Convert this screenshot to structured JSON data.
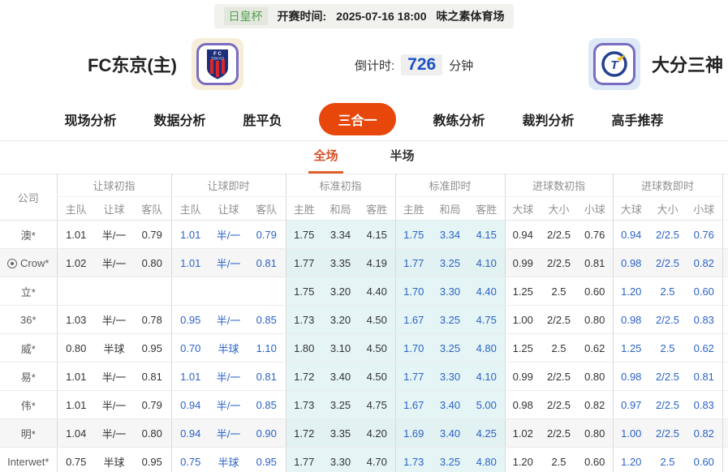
{
  "header": {
    "league": "日皇杯",
    "kickoff_label": "开赛时间:",
    "kickoff_time": "2025-07-16 18:00",
    "venue": "味之素体育场",
    "home_team": "FC东京(主)",
    "away_team": "大分三神",
    "countdown_label": "倒计时:",
    "countdown_value": "726",
    "countdown_unit": "分钟"
  },
  "nav": {
    "tabs": [
      {
        "label": "现场分析",
        "active": false
      },
      {
        "label": "数据分析",
        "active": false
      },
      {
        "label": "胜平负",
        "active": false
      },
      {
        "label": "三合一",
        "active": true
      },
      {
        "label": "教练分析",
        "active": false
      },
      {
        "label": "裁判分析",
        "active": false
      },
      {
        "label": "高手推荐",
        "active": false
      }
    ]
  },
  "subtabs": [
    {
      "label": "全场",
      "active": true
    },
    {
      "label": "半场",
      "active": false
    }
  ],
  "colors": {
    "accent_orange": "#e8470b",
    "subtab_orange": "#d4532a",
    "live_blue": "#2c63c8",
    "countdown_blue": "#1b50c4",
    "league_green": "#4fa44f",
    "standard_cyan_bg": "#e5f5f5"
  },
  "table": {
    "company_header": "公司",
    "groups": [
      {
        "label": "让球初指",
        "cols": [
          "主队",
          "让球",
          "客队"
        ],
        "live": false,
        "cyan": false
      },
      {
        "label": "让球即时",
        "cols": [
          "主队",
          "让球",
          "客队"
        ],
        "live": true,
        "cyan": false
      },
      {
        "label": "标准初指",
        "cols": [
          "主胜",
          "和局",
          "客胜"
        ],
        "live": false,
        "cyan": true
      },
      {
        "label": "标准即时",
        "cols": [
          "主胜",
          "和局",
          "客胜"
        ],
        "live": true,
        "cyan": true
      },
      {
        "label": "进球数初指",
        "cols": [
          "大球",
          "大小",
          "小球"
        ],
        "live": false,
        "cyan": false
      },
      {
        "label": "进球数即时",
        "cols": [
          "大球",
          "大小",
          "小球"
        ],
        "live": true,
        "cyan": false
      }
    ],
    "rows": [
      {
        "company": "澳*",
        "icon": false,
        "highlight": false,
        "handicap_initial": [
          "1.01",
          "半/一",
          "0.79"
        ],
        "handicap_live": [
          "1.01",
          "半/一",
          "0.79"
        ],
        "standard_initial": [
          "1.75",
          "3.34",
          "4.15"
        ],
        "standard_live": [
          "1.75",
          "3.34",
          "4.15"
        ],
        "goals_initial": [
          "0.94",
          "2/2.5",
          "0.76"
        ],
        "goals_live": [
          "0.94",
          "2/2.5",
          "0.76"
        ]
      },
      {
        "company": "Crow*",
        "icon": true,
        "highlight": true,
        "handicap_initial": [
          "1.02",
          "半/一",
          "0.80"
        ],
        "handicap_live": [
          "1.01",
          "半/一",
          "0.81"
        ],
        "standard_initial": [
          "1.77",
          "3.35",
          "4.19"
        ],
        "standard_live": [
          "1.77",
          "3.25",
          "4.10"
        ],
        "goals_initial": [
          "0.99",
          "2/2.5",
          "0.81"
        ],
        "goals_live": [
          "0.98",
          "2/2.5",
          "0.82"
        ]
      },
      {
        "company": "立*",
        "icon": false,
        "highlight": false,
        "handicap_initial": [
          "",
          "",
          ""
        ],
        "handicap_live": [
          "",
          "",
          ""
        ],
        "standard_initial": [
          "1.75",
          "3.20",
          "4.40"
        ],
        "standard_live": [
          "1.70",
          "3.30",
          "4.40"
        ],
        "goals_initial": [
          "1.25",
          "2.5",
          "0.60"
        ],
        "goals_live": [
          "1.20",
          "2.5",
          "0.60"
        ]
      },
      {
        "company": "36*",
        "icon": false,
        "highlight": false,
        "handicap_initial": [
          "1.03",
          "半/一",
          "0.78"
        ],
        "handicap_live": [
          "0.95",
          "半/一",
          "0.85"
        ],
        "standard_initial": [
          "1.73",
          "3.20",
          "4.50"
        ],
        "standard_live": [
          "1.67",
          "3.25",
          "4.75"
        ],
        "goals_initial": [
          "1.00",
          "2/2.5",
          "0.80"
        ],
        "goals_live": [
          "0.98",
          "2/2.5",
          "0.83"
        ]
      },
      {
        "company": "威*",
        "icon": false,
        "highlight": false,
        "handicap_initial": [
          "0.80",
          "半球",
          "0.95"
        ],
        "handicap_live": [
          "0.70",
          "半球",
          "1.10"
        ],
        "standard_initial": [
          "1.80",
          "3.10",
          "4.50"
        ],
        "standard_live": [
          "1.70",
          "3.25",
          "4.80"
        ],
        "goals_initial": [
          "1.25",
          "2.5",
          "0.62"
        ],
        "goals_live": [
          "1.25",
          "2.5",
          "0.62"
        ]
      },
      {
        "company": "易*",
        "icon": false,
        "highlight": false,
        "handicap_initial": [
          "1.01",
          "半/一",
          "0.81"
        ],
        "handicap_live": [
          "1.01",
          "半/一",
          "0.81"
        ],
        "standard_initial": [
          "1.72",
          "3.40",
          "4.50"
        ],
        "standard_live": [
          "1.77",
          "3.30",
          "4.10"
        ],
        "goals_initial": [
          "0.99",
          "2/2.5",
          "0.80"
        ],
        "goals_live": [
          "0.98",
          "2/2.5",
          "0.81"
        ]
      },
      {
        "company": "伟*",
        "icon": false,
        "highlight": false,
        "handicap_initial": [
          "1.01",
          "半/一",
          "0.79"
        ],
        "handicap_live": [
          "0.94",
          "半/一",
          "0.85"
        ],
        "standard_initial": [
          "1.73",
          "3.25",
          "4.75"
        ],
        "standard_live": [
          "1.67",
          "3.40",
          "5.00"
        ],
        "goals_initial": [
          "0.98",
          "2/2.5",
          "0.82"
        ],
        "goals_live": [
          "0.97",
          "2/2.5",
          "0.83"
        ]
      },
      {
        "company": "明*",
        "icon": false,
        "highlight": true,
        "handicap_initial": [
          "1.04",
          "半/一",
          "0.80"
        ],
        "handicap_live": [
          "0.94",
          "半/一",
          "0.90"
        ],
        "standard_initial": [
          "1.72",
          "3.35",
          "4.20"
        ],
        "standard_live": [
          "1.69",
          "3.40",
          "4.25"
        ],
        "goals_initial": [
          "1.02",
          "2/2.5",
          "0.80"
        ],
        "goals_live": [
          "1.00",
          "2/2.5",
          "0.82"
        ]
      },
      {
        "company": "Interwet*",
        "icon": false,
        "highlight": false,
        "handicap_initial": [
          "0.75",
          "半球",
          "0.95"
        ],
        "handicap_live": [
          "0.75",
          "半球",
          "0.95"
        ],
        "standard_initial": [
          "1.77",
          "3.30",
          "4.70"
        ],
        "standard_live": [
          "1.73",
          "3.25",
          "4.80"
        ],
        "goals_initial": [
          "1.20",
          "2.5",
          "0.60"
        ],
        "goals_live": [
          "1.20",
          "2.5",
          "0.60"
        ]
      }
    ]
  }
}
